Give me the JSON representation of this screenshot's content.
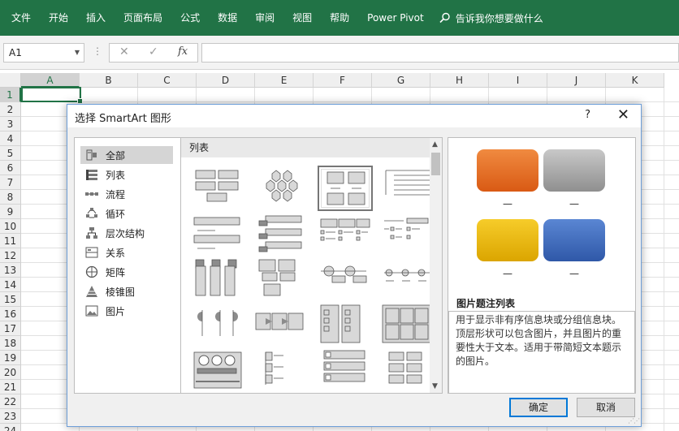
{
  "ribbon": {
    "tabs": [
      "文件",
      "开始",
      "插入",
      "页面布局",
      "公式",
      "数据",
      "审阅",
      "视图",
      "帮助",
      "Power Pivot"
    ],
    "tell_me": "告诉我你想要做什么"
  },
  "formula_bar": {
    "name_box": "A1",
    "fx": "fx",
    "formula": ""
  },
  "sheet": {
    "columns": [
      "A",
      "B",
      "C",
      "D",
      "E",
      "F",
      "G",
      "H",
      "I",
      "J",
      "K"
    ],
    "rows": [
      "1",
      "2",
      "3",
      "4",
      "5",
      "6",
      "7",
      "8",
      "9",
      "10",
      "11",
      "12",
      "13",
      "14",
      "15",
      "16",
      "17",
      "18",
      "19",
      "20",
      "21",
      "22",
      "23",
      "24"
    ],
    "active_cell": "A1"
  },
  "dialog": {
    "title": "选择 SmartArt 图形",
    "help": "?",
    "categories": [
      {
        "label": "全部",
        "icon": "all-icon",
        "selected": true
      },
      {
        "label": "列表",
        "icon": "list-icon"
      },
      {
        "label": "流程",
        "icon": "process-icon"
      },
      {
        "label": "循环",
        "icon": "cycle-icon"
      },
      {
        "label": "层次结构",
        "icon": "hierarchy-icon"
      },
      {
        "label": "关系",
        "icon": "relationship-icon"
      },
      {
        "label": "矩阵",
        "icon": "matrix-icon"
      },
      {
        "label": "棱锥图",
        "icon": "pyramid-icon"
      },
      {
        "label": "图片",
        "icon": "picture-icon"
      }
    ],
    "gallery_header": "列表",
    "selected_layout": 2,
    "preview": {
      "colors": [
        "#e0651f",
        "#a3a3a3",
        "#e8b60e",
        "#3d67b8"
      ],
      "dash": "—",
      "layout_name": "图片题注列表",
      "description": "用于显示非有序信息块或分组信息块。顶层形状可以包含图片，并且图片的重要性大于文本。适用于带简短文本题示的图片。"
    },
    "ok_label": "确定",
    "cancel_label": "取消"
  }
}
